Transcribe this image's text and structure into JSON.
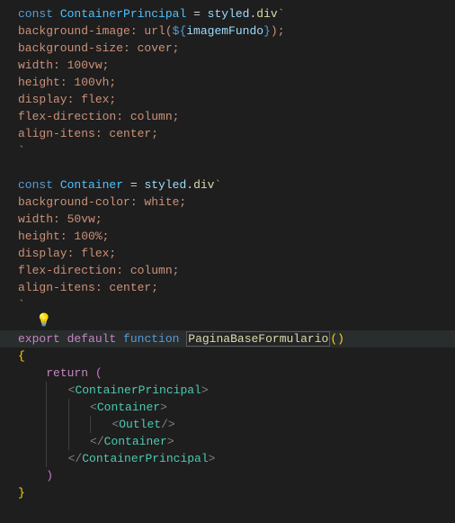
{
  "l1": {
    "const": "const",
    "name": "ContainerPrincipal",
    "eq": " = ",
    "styled": "styled",
    "dot": ".",
    "div": "div",
    "tick": "`"
  },
  "l2": {
    "prop": "background-image",
    "val1": ": url(",
    "interp1": "${",
    "var": "imagemFundo",
    "interp2": "}",
    "val2": ");"
  },
  "l3": {
    "prop": "background-size",
    "val": ": cover;"
  },
  "l4": {
    "prop": "width",
    "val": ": 100vw;"
  },
  "l5": {
    "prop": "height",
    "val": ": 100vh;"
  },
  "l6": {
    "prop": "display",
    "val": ": flex;"
  },
  "l7": {
    "prop": "flex-direction",
    "val": ": column;"
  },
  "l8": {
    "prop": "align-itens",
    "val": ": center;"
  },
  "l9": "`",
  "l11": {
    "const": "const",
    "name": "Container",
    "eq": " = ",
    "styled": "styled",
    "dot": ".",
    "div": "div",
    "tick": "`"
  },
  "l12": {
    "prop": "background-color",
    "val": ": white;"
  },
  "l13": {
    "prop": "width",
    "val": ": 50vw;"
  },
  "l14": {
    "prop": "height",
    "val": ": 100%;"
  },
  "l15": {
    "prop": "display",
    "val": ": flex;"
  },
  "l16": {
    "prop": "flex-direction",
    "val": ": column;"
  },
  "l17": {
    "prop": "align-itens",
    "val": ": center;"
  },
  "l18": "`",
  "bulb": "💡",
  "l20": {
    "export": "export",
    "default": "default",
    "function": "function",
    "name": "PaginaBaseFormulario",
    "paren": "()"
  },
  "l21": "{",
  "l22": {
    "return": "return",
    "paren": " ("
  },
  "l23": {
    "open": "<",
    "name": "ContainerPrincipal",
    "close": ">"
  },
  "l24": {
    "open": "<",
    "name": "Container",
    "close": ">"
  },
  "l25": {
    "open": "<",
    "name": "Outlet",
    "close": "/>"
  },
  "l26": {
    "open": "</",
    "name": "Container",
    "close": ">"
  },
  "l27": {
    "open": "</",
    "name": "ContainerPrincipal",
    "close": ">"
  },
  "l28": ")",
  "l29": "}"
}
